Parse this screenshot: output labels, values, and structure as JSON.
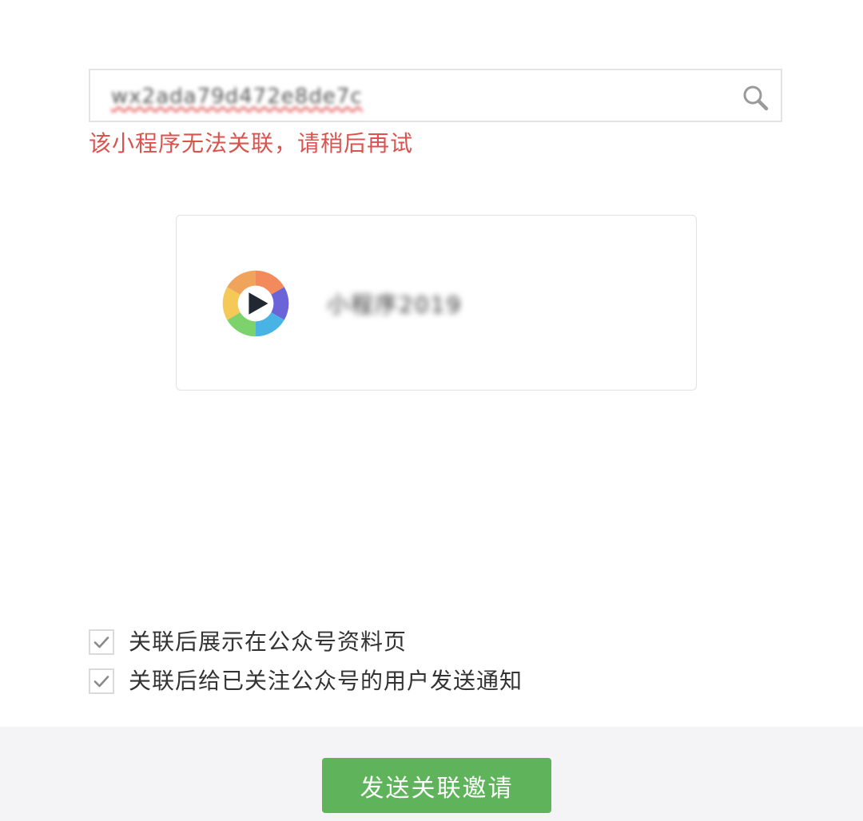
{
  "search": {
    "value": "wx2ada79d472e8de7c",
    "icon": "search-icon"
  },
  "error": {
    "message": "该小程序无法关联，请稍后再试",
    "color": "#d9534f"
  },
  "app_card": {
    "logo_icon": "shutter-play-logo",
    "name": "小程序2019"
  },
  "options": [
    {
      "label": "关联后展示在公众号资料页",
      "checked": true
    },
    {
      "label": "关联后给已关注公众号的用户发送通知",
      "checked": true
    }
  ],
  "footer": {
    "send_label": "发送关联邀请",
    "accent": "#5fb45b"
  }
}
